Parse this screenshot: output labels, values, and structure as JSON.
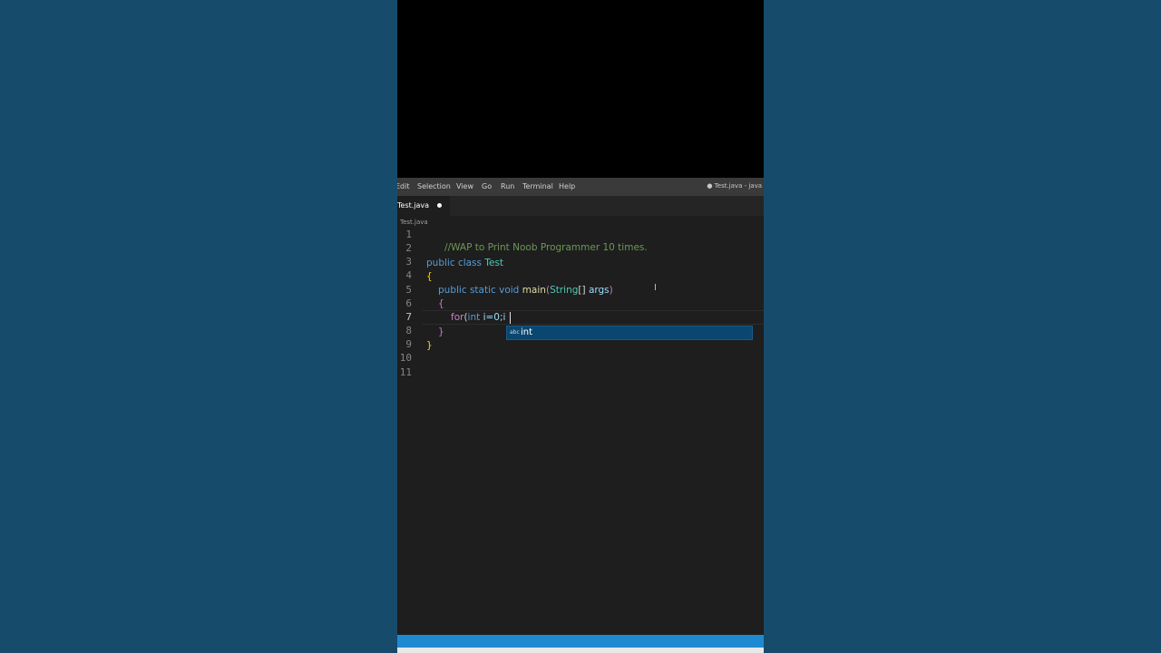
{
  "menubar": {
    "items": [
      "Edit",
      "Selection",
      "View",
      "Go",
      "Run",
      "Terminal",
      "Help"
    ],
    "window_title": "● Test.java - java"
  },
  "tab": {
    "filename": "Test.java",
    "modified_icon": "dot-icon"
  },
  "breadcrumb": "Test.java",
  "editor": {
    "line_numbers": [
      "1",
      "2",
      "3",
      "4",
      "5",
      "6",
      "7",
      "8",
      "9",
      "10",
      "11"
    ],
    "active_line": "7",
    "lines": {
      "l1": {
        "comment": "//WAP to Print Noob Programmer 10 times."
      },
      "l3": {
        "kw1": "public",
        "kw2": "class",
        "cls": "Test"
      },
      "l4": {
        "brace": "{"
      },
      "l5": {
        "kw1": "public",
        "kw2": "static",
        "kw3": "void",
        "fn": "main",
        "open": "(",
        "type": "String",
        "brackets": "[]",
        "arg": "args",
        "close": ")"
      },
      "l6": {
        "brace": "{"
      },
      "l7": {
        "kw": "for",
        "open": "(",
        "type": "int",
        "rest": "i=0;i"
      },
      "l8": {
        "brace": "}"
      },
      "l9": {
        "brace": "}"
      }
    }
  },
  "suggestion": {
    "icon": "abc",
    "label": "int"
  },
  "colors": {
    "background": "#174b6c",
    "editor_bg": "#1e1e1e",
    "statusbar": "#1f8ad2",
    "suggest_bg": "#094771"
  }
}
